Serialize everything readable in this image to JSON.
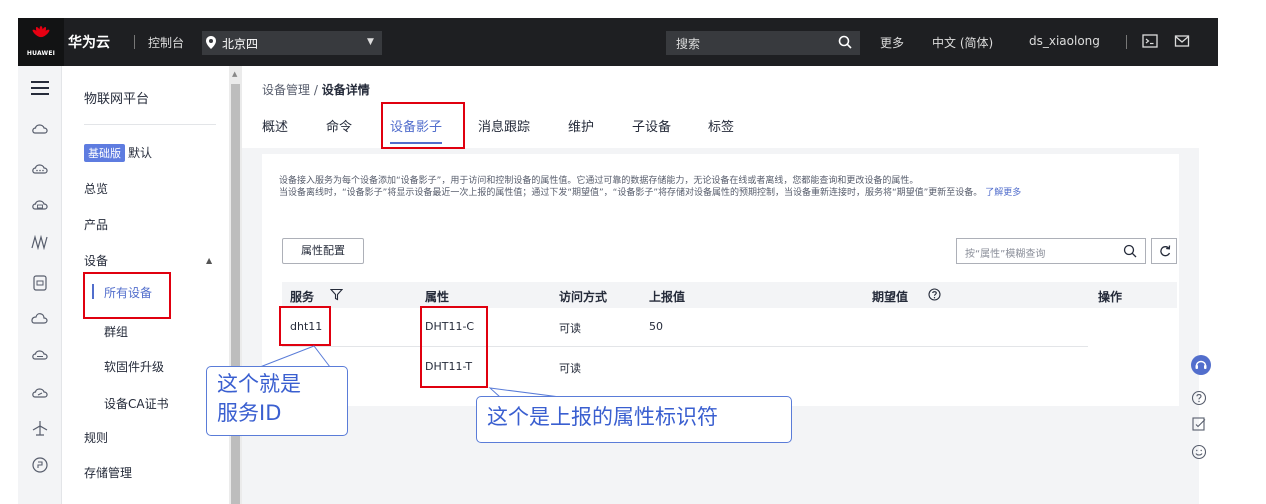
{
  "topbar": {
    "logo_text": "HUAWEI",
    "brand": "华为云",
    "console": "控制台",
    "region": "北京四",
    "search_placeholder": "搜索",
    "more": "更多",
    "language": "中文 (简体)",
    "username": "ds_xiaolong"
  },
  "sidebar": {
    "title": "物联网平台",
    "edition_badge": "基础版",
    "edition_label": "默认",
    "items": [
      {
        "label": "总览"
      },
      {
        "label": "产品"
      },
      {
        "label": "设备"
      },
      {
        "label": "所有设备"
      },
      {
        "label": "群组"
      },
      {
        "label": "软固件升级"
      },
      {
        "label": "设备CA证书"
      },
      {
        "label": "规则"
      },
      {
        "label": "存储管理"
      }
    ]
  },
  "main": {
    "breadcrumb_parent": "设备管理",
    "breadcrumb_sep": " / ",
    "breadcrumb_current": "设备详情",
    "tabs": [
      "概述",
      "命令",
      "设备影子",
      "消息跟踪",
      "维护",
      "子设备",
      "标签"
    ],
    "active_tab": "设备影子",
    "description_line1": "设备接入服务为每个设备添加“设备影子”，用于访问和控制设备的属性值。它通过可靠的数据存储能力，无论设备在线或者离线，您都能查询和更改设备的属性。",
    "description_line2": "当设备离线时，“设备影子”将显示设备最近一次上报的属性值；通过下发“期望值”，“设备影子”将存储对设备属性的预期控制，当设备重新连接时，服务将“期望值”更新至设备。",
    "learn_more": "了解更多",
    "config_button": "属性配置",
    "filter_placeholder": "按“属性”模糊查询",
    "table": {
      "columns": [
        "服务",
        "属性",
        "访问方式",
        "上报值",
        "期望值",
        "操作"
      ],
      "rows": [
        {
          "service": "dht11",
          "property": "DHT11-C",
          "access": "可读",
          "reported": "50"
        },
        {
          "service": "",
          "property": "DHT11-T",
          "access": "可读",
          "reported": ""
        }
      ]
    }
  },
  "annotations": {
    "service_id_line1": "这个就是",
    "service_id_line2": "服务ID",
    "property_id": "这个是上报的属性标识符"
  },
  "colors": {
    "topbar_bg": "#1e1f22",
    "accent": "#526ecc",
    "annotation_red": "#e0000f",
    "annotation_blue": "#3a5fd0",
    "page_bg": "#f3f4f6"
  }
}
